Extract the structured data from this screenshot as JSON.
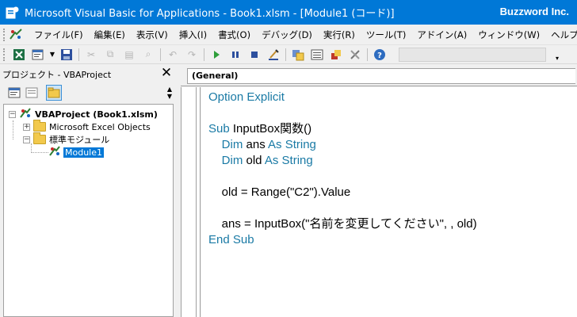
{
  "window": {
    "title": "Microsoft Visual Basic for Applications - Book1.xlsm - [Module1 (コード)]",
    "brand": "Buzzword Inc.",
    "title_bg": "#0078d7"
  },
  "menu": {
    "items": [
      "ファイル(F)",
      "編集(E)",
      "表示(V)",
      "挿入(I)",
      "書式(O)",
      "デバッグ(D)",
      "実行(R)",
      "ツール(T)",
      "アドイン(A)",
      "ウィンドウ(W)",
      "ヘルプ(H)"
    ]
  },
  "toolbar": {
    "icons": [
      "excel-view-icon",
      "insert-module-icon",
      "save-icon",
      "cut-icon",
      "copy-icon",
      "paste-icon",
      "find-icon",
      "undo-icon",
      "redo-icon",
      "run-icon",
      "break-icon",
      "reset-icon",
      "design-mode-icon",
      "project-explorer-icon",
      "properties-icon",
      "object-browser-icon",
      "toolbox-icon",
      "help-icon"
    ]
  },
  "project": {
    "pane_title": "プロジェクト - VBAProject",
    "close_glyph": "✕",
    "tree": {
      "root": "VBAProject (Book1.xlsm)",
      "excel_objects": "Microsoft Excel Objects",
      "modules_folder": "標準モジュール",
      "module": "Module1"
    }
  },
  "code": {
    "procedure_combo": "(General)",
    "lines": [
      {
        "parts": [
          [
            "kw",
            "Option Explicit"
          ]
        ]
      },
      {
        "parts": []
      },
      {
        "parts": [
          [
            "kw",
            "Sub"
          ],
          [
            "",
            " InputBox関数()"
          ]
        ]
      },
      {
        "parts": [
          [
            "",
            "    "
          ],
          [
            "kw",
            "Dim"
          ],
          [
            "",
            " ans "
          ],
          [
            "kw",
            "As String"
          ]
        ]
      },
      {
        "parts": [
          [
            "",
            "    "
          ],
          [
            "kw",
            "Dim"
          ],
          [
            "",
            " old "
          ],
          [
            "kw",
            "As String"
          ]
        ]
      },
      {
        "parts": []
      },
      {
        "parts": [
          [
            "",
            "    old = Range(\"C2\").Value"
          ]
        ]
      },
      {
        "parts": []
      },
      {
        "parts": [
          [
            "",
            "    ans = InputBox(\"名前を変更してください\", , old)"
          ]
        ]
      },
      {
        "parts": [
          [
            "kw",
            "End Sub"
          ]
        ]
      }
    ]
  }
}
